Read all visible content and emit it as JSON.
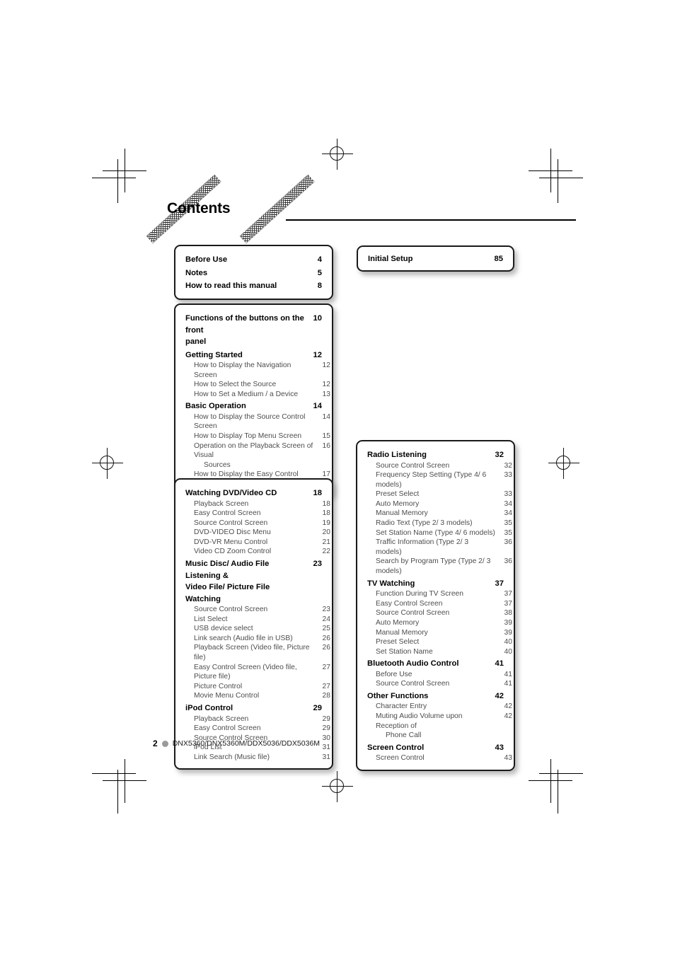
{
  "page": {
    "title": "Contents",
    "footer": {
      "page_number": "2",
      "models": "DNX5360/DNX5360M/DDX5036/DDX5036M"
    }
  },
  "boxes": {
    "intro": {
      "entries": [
        {
          "label": "Before Use",
          "page": "4",
          "level": "major"
        },
        {
          "label": "Notes",
          "page": "5",
          "level": "major"
        },
        {
          "label": "How to read this manual",
          "page": "8",
          "level": "major"
        }
      ]
    },
    "initial_setup": {
      "entries": [
        {
          "label": "Initial Setup",
          "page": "85",
          "level": "major"
        }
      ]
    },
    "basics": {
      "entries": [
        {
          "label": "Functions of the buttons on the front",
          "label_cont": "panel",
          "page": "10",
          "level": "major",
          "wrap": true
        },
        {
          "label": "Getting Started",
          "page": "12",
          "level": "major"
        },
        {
          "label": "How to Display the Navigation Screen",
          "page": "12",
          "level": "minor"
        },
        {
          "label": "How to Select the Source",
          "page": "12",
          "level": "minor"
        },
        {
          "label": "How to Set a Medium / a Device",
          "page": "13",
          "level": "minor"
        },
        {
          "label": "Basic Operation",
          "page": "14",
          "level": "major"
        },
        {
          "label": "How to Display the Source Control Screen",
          "page": "14",
          "level": "minor"
        },
        {
          "label": "How to Display Top Menu Screen",
          "page": "15",
          "level": "minor"
        },
        {
          "label": "Operation on the Playback Screen of Visual",
          "label_cont": "Sources",
          "page": "16",
          "level": "minor",
          "wrap": true
        },
        {
          "label": "How to Display the Easy Control Screen",
          "page": "17",
          "level": "minor"
        }
      ]
    },
    "discs": {
      "entries": [
        {
          "label": "Watching DVD/Video CD",
          "page": "18",
          "level": "major"
        },
        {
          "label": "Playback Screen",
          "page": "18",
          "level": "minor"
        },
        {
          "label": "Easy Control Screen",
          "page": "18",
          "level": "minor"
        },
        {
          "label": "Source Control Screen",
          "page": "19",
          "level": "minor"
        },
        {
          "label": "DVD-VIDEO Disc Menu",
          "page": "20",
          "level": "minor"
        },
        {
          "label": "DVD-VR Menu Control",
          "page": "21",
          "level": "minor"
        },
        {
          "label": "Video CD Zoom Control",
          "page": "22",
          "level": "minor"
        },
        {
          "label": "Music Disc/ Audio File Listening &",
          "label_cont": "Video File/ Picture File Watching",
          "page": "23",
          "level": "major",
          "wrap": true
        },
        {
          "label": "Source Control Screen",
          "page": "23",
          "level": "minor"
        },
        {
          "label": "List Select",
          "page": "24",
          "level": "minor"
        },
        {
          "label": "USB device select",
          "page": "25",
          "level": "minor"
        },
        {
          "label": "Link search (Audio file in USB)",
          "page": "26",
          "level": "minor"
        },
        {
          "label": "Playback Screen (Video file, Picture file)",
          "page": "26",
          "level": "minor"
        },
        {
          "label": "Easy Control Screen (Video file, Picture file)",
          "page": "27",
          "level": "minor"
        },
        {
          "label": "Picture Control",
          "page": "27",
          "level": "minor"
        },
        {
          "label": "Movie Menu Control",
          "page": "28",
          "level": "minor"
        },
        {
          "label": "iPod Control",
          "page": "29",
          "level": "major"
        },
        {
          "label": "Playback Screen",
          "page": "29",
          "level": "minor"
        },
        {
          "label": "Easy Control Screen",
          "page": "29",
          "level": "minor"
        },
        {
          "label": "Source Control Screen",
          "page": "30",
          "level": "minor"
        },
        {
          "label": "iPod List",
          "page": "31",
          "level": "minor"
        },
        {
          "label": "Link Search (Music file)",
          "page": "31",
          "level": "minor"
        }
      ]
    },
    "tuner": {
      "entries": [
        {
          "label": "Radio Listening",
          "page": "32",
          "level": "major"
        },
        {
          "label": "Source Control Screen",
          "page": "32",
          "level": "minor"
        },
        {
          "label": "Frequency Step Setting (Type 4/ 6 models)",
          "page": "33",
          "level": "minor"
        },
        {
          "label": "Preset Select",
          "page": "33",
          "level": "minor"
        },
        {
          "label": "Auto Memory",
          "page": "34",
          "level": "minor"
        },
        {
          "label": "Manual Memory",
          "page": "34",
          "level": "minor"
        },
        {
          "label": "Radio Text (Type 2/ 3 models)",
          "page": "35",
          "level": "minor"
        },
        {
          "label": "Set Station Name (Type 4/ 6 models)",
          "page": "35",
          "level": "minor"
        },
        {
          "label": "Traffic Information (Type 2/ 3 models)",
          "page": "36",
          "level": "minor"
        },
        {
          "label": "Search by Program Type (Type 2/ 3 models)",
          "page": "36",
          "level": "minor"
        },
        {
          "label": "TV Watching",
          "page": "37",
          "level": "major"
        },
        {
          "label": "Function During TV Screen",
          "page": "37",
          "level": "minor"
        },
        {
          "label": "Easy Control Screen",
          "page": "37",
          "level": "minor"
        },
        {
          "label": "Source Control Screen",
          "page": "38",
          "level": "minor"
        },
        {
          "label": "Auto Memory",
          "page": "39",
          "level": "minor"
        },
        {
          "label": "Manual Memory",
          "page": "39",
          "level": "minor"
        },
        {
          "label": "Preset Select",
          "page": "40",
          "level": "minor"
        },
        {
          "label": "Set Station Name",
          "page": "40",
          "level": "minor"
        },
        {
          "label": "Bluetooth Audio Control",
          "page": "41",
          "level": "major"
        },
        {
          "label": "Before Use",
          "page": "41",
          "level": "minor"
        },
        {
          "label": "Source Control Screen",
          "page": "41",
          "level": "minor"
        },
        {
          "label": "Other Functions",
          "page": "42",
          "level": "major"
        },
        {
          "label": "Character Entry",
          "page": "42",
          "level": "minor"
        },
        {
          "label": "Muting Audio Volume upon Reception of",
          "label_cont": "Phone Call",
          "page": "42",
          "level": "minor",
          "wrap": true
        },
        {
          "label": "Screen Control",
          "page": "43",
          "level": "major"
        },
        {
          "label": "Screen Control",
          "page": "43",
          "level": "minor"
        }
      ]
    }
  }
}
